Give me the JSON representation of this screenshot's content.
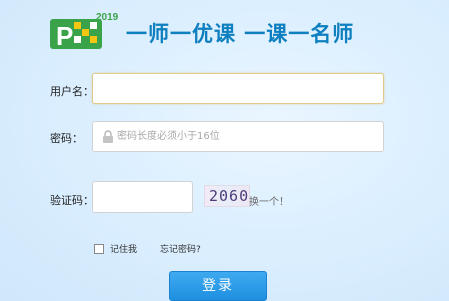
{
  "header": {
    "logo_year": "2019",
    "logo_letter": "P",
    "slogan": "一师一优课 一课一名师"
  },
  "form": {
    "username_label": "用户名：",
    "username_value": "",
    "password_label": "密码：",
    "password_placeholder": "密码长度必须小于16位",
    "captcha_label": "验证码：",
    "captcha_value": "",
    "captcha_code": "2060",
    "captcha_refresh": "换一个！",
    "remember_label": "记住我",
    "forgot_link": "忘记密码?",
    "login_button": "登录"
  },
  "colors": {
    "accent": "#0e7fbf",
    "logo_green": "#3aa34a",
    "logo_yellow": "#f3c613",
    "button_blue": "#2898e8"
  },
  "icons": [
    "lock-icon"
  ]
}
